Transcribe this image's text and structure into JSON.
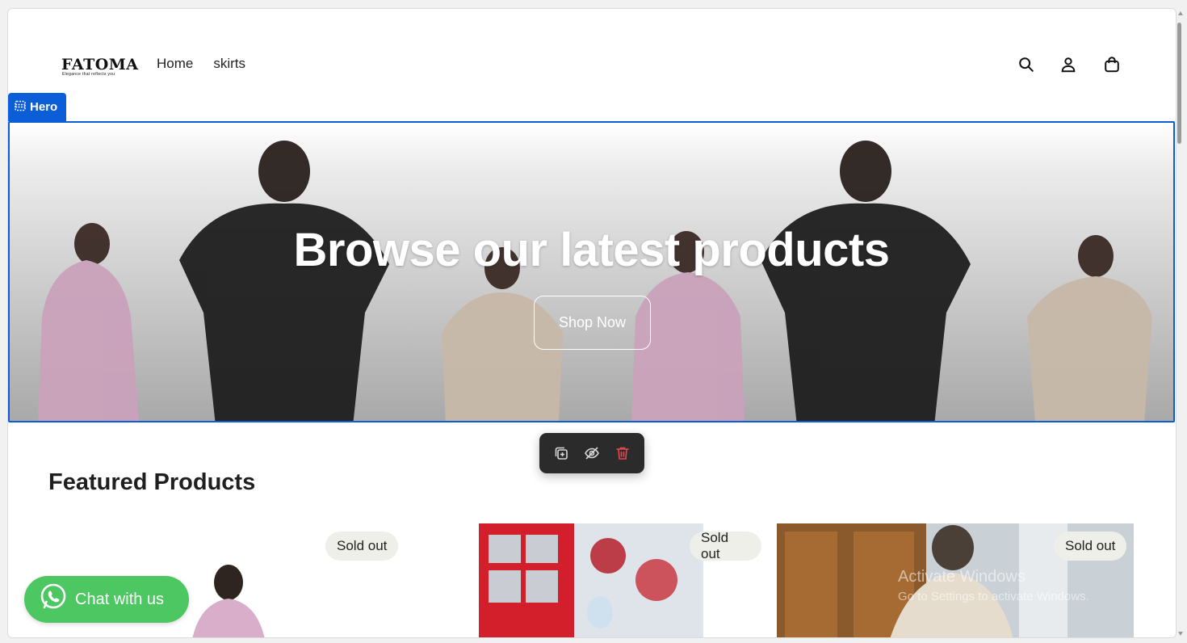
{
  "brand": {
    "name": "FATOMA",
    "tagline": "Elegance that reflects you"
  },
  "nav": {
    "items": [
      "Home",
      "skirts"
    ]
  },
  "header_icons": [
    "search-icon",
    "account-icon",
    "cart-icon"
  ],
  "editor": {
    "section_tag": "Hero",
    "toolbar_icons": [
      "duplicate-icon",
      "hide-icon",
      "delete-icon"
    ]
  },
  "hero": {
    "heading": "Browse our latest products",
    "button_label": "Shop Now"
  },
  "featured": {
    "title": "Featured Products",
    "products": [
      {
        "badge": "Sold out"
      },
      {
        "badge": "Sold out"
      },
      {
        "badge": "Sold out"
      }
    ]
  },
  "chat": {
    "label": "Chat with us"
  },
  "watermark": {
    "line1": "Activate Windows",
    "line2": "Go to Settings to activate Windows."
  },
  "colors": {
    "accent": "#0b5ed7",
    "chat": "#4dc762",
    "toolbar": "#2b2b2b",
    "delete": "#e5484d"
  }
}
